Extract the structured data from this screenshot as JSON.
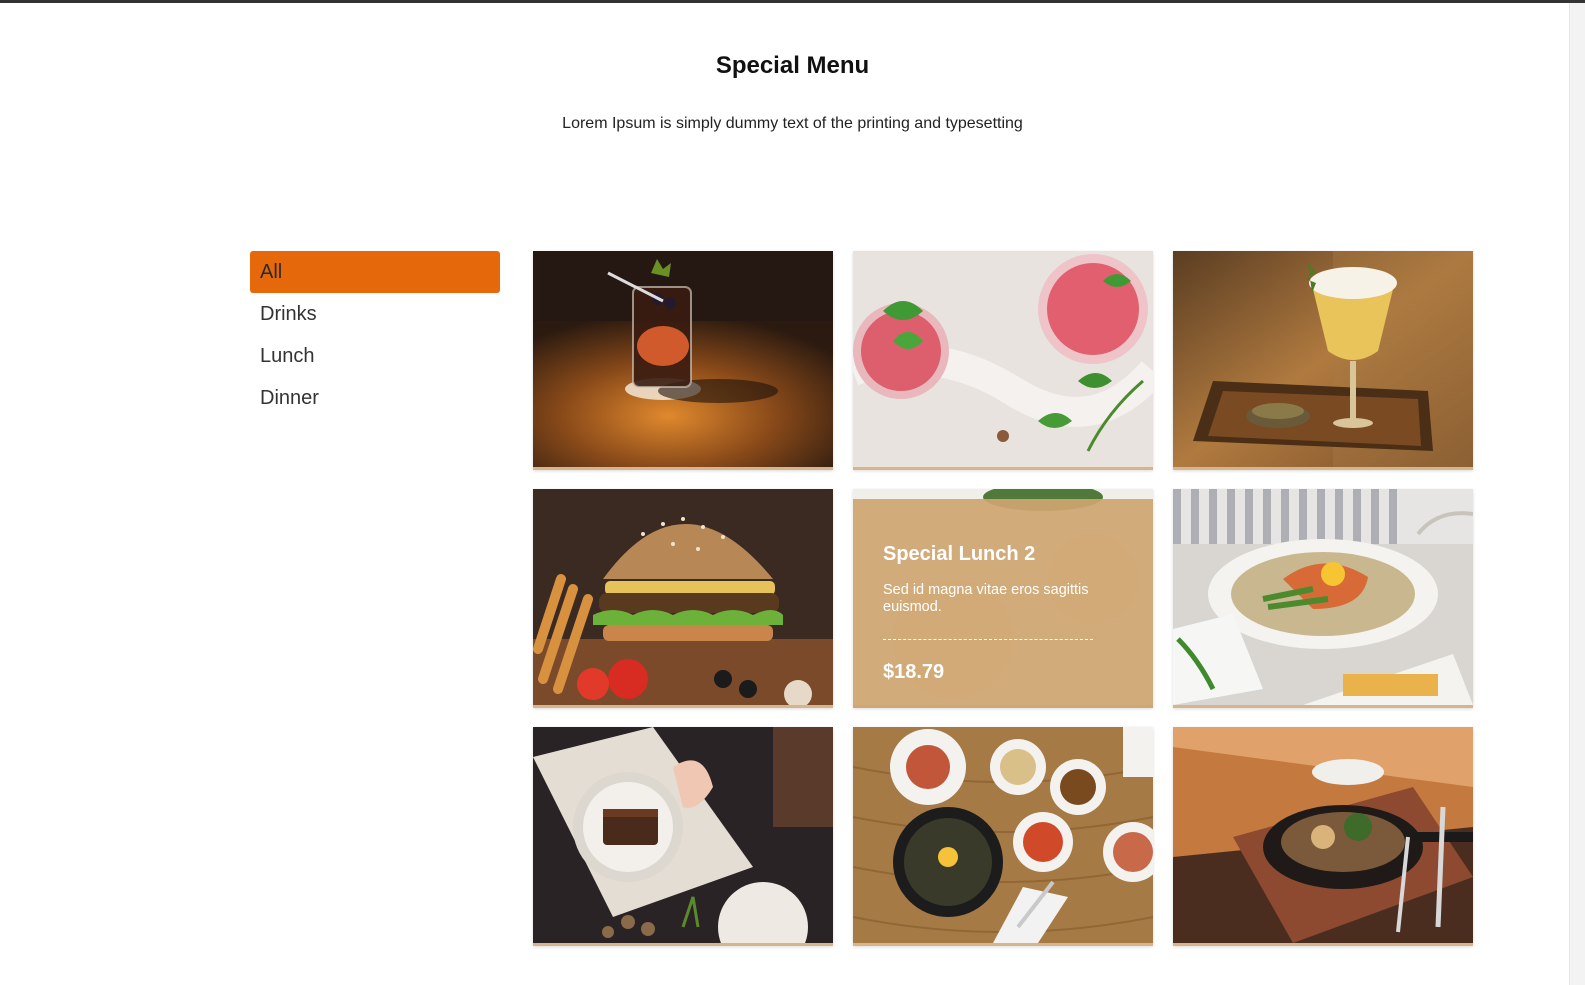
{
  "header": {
    "title": "Special Menu",
    "subtitle": "Lorem Ipsum is simply dummy text of the printing and typesetting"
  },
  "filters": {
    "items": [
      {
        "label": "All",
        "active": true
      },
      {
        "label": "Drinks",
        "active": false
      },
      {
        "label": "Lunch",
        "active": false
      },
      {
        "label": "Dinner",
        "active": false
      }
    ]
  },
  "colors": {
    "accent": "#e5690b",
    "card_footer": "#d7b58c",
    "overlay": "#cfa571"
  },
  "menu": {
    "items": [
      {
        "photo": "cocktail-on-wood-table"
      },
      {
        "photo": "two-pink-drinks-with-mint"
      },
      {
        "photo": "foamy-drink-in-tray"
      },
      {
        "photo": "burger-and-fries"
      },
      {
        "photo": "salad-bowl",
        "hover": true,
        "title": "Special Lunch 2",
        "description": "Sed id magna vitae eros sagittis euismod.",
        "price": "$18.79"
      },
      {
        "photo": "salmon-plate"
      },
      {
        "photo": "dessert-on-dark-table"
      },
      {
        "photo": "korean-bibimbap-table"
      },
      {
        "photo": "sizzling-skillet"
      }
    ]
  }
}
